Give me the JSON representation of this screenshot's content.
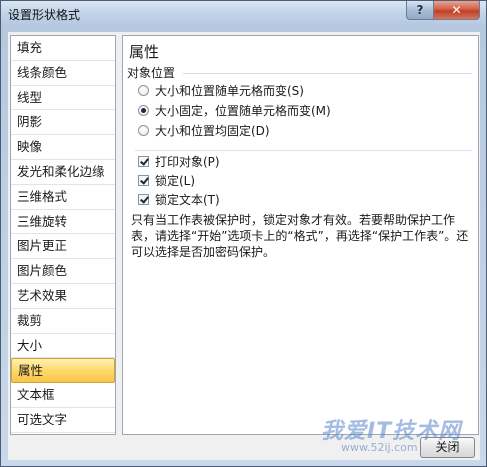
{
  "window": {
    "title": "设置形状格式",
    "help_glyph": "?",
    "close_glyph": "✕"
  },
  "sidebar": {
    "items": [
      {
        "label": "填充"
      },
      {
        "label": "线条颜色"
      },
      {
        "label": "线型"
      },
      {
        "label": "阴影"
      },
      {
        "label": "映像"
      },
      {
        "label": "发光和柔化边缘"
      },
      {
        "label": "三维格式"
      },
      {
        "label": "三维旋转"
      },
      {
        "label": "图片更正"
      },
      {
        "label": "图片颜色"
      },
      {
        "label": "艺术效果"
      },
      {
        "label": "裁剪"
      },
      {
        "label": "大小"
      },
      {
        "label": "属性",
        "selected": true
      },
      {
        "label": "文本框"
      },
      {
        "label": "可选文字"
      }
    ]
  },
  "panel": {
    "title": "属性",
    "group_label": "对象位置",
    "radios": [
      {
        "label": "大小和位置随单元格而变(S)",
        "checked": false
      },
      {
        "label": "大小固定，位置随单元格而变(M)",
        "checked": true
      },
      {
        "label": "大小和位置均固定(D)",
        "checked": false
      }
    ],
    "checkboxes": [
      {
        "label": "打印对象(P)",
        "checked": true
      },
      {
        "label": "锁定(L)",
        "checked": true
      },
      {
        "label": "锁定文本(T)",
        "checked": true
      }
    ],
    "note": "只有当工作表被保护时，锁定对象才有效。若要帮助保护工作表，请选择“开始”选项卡上的“格式”，再选择“保护工作表”。还可以选择是否加密码保护。"
  },
  "footer": {
    "close_label": "关闭"
  },
  "watermark": {
    "text": "我爱IT技术网",
    "url": "www.52ij.com"
  }
}
